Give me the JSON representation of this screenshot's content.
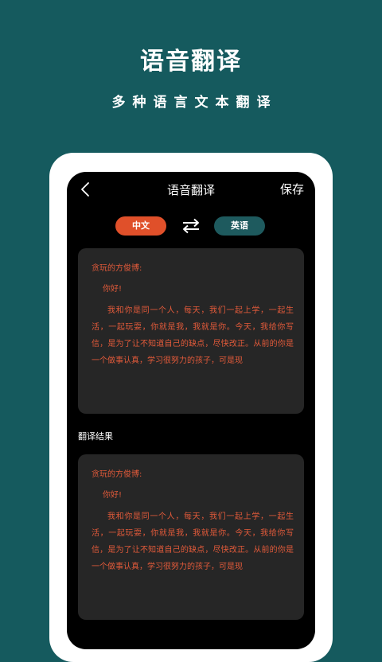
{
  "promo": {
    "title": "语音翻译",
    "subtitle": "多种语言文本翻译"
  },
  "app": {
    "nav": {
      "title": "语音翻译",
      "save_label": "保存",
      "back_icon": "chevron-left-icon"
    },
    "languages": {
      "source": "中文",
      "target": "英语",
      "swap_icon": "swap-arrows-icon"
    },
    "source_card": {
      "greeting": "贪玩的方俊博:",
      "salutation": "你好!",
      "body": "我和你是同一个人，每天，我们一起上学，一起生活，一起玩耍，你就是我，我就是你。今天，我给你写信，是为了让不知道自己的缺点，尽快改正。从前的你是一个做事认真，学习很努力的孩子，可是现"
    },
    "result_label": "翻译结果",
    "result_card": {
      "greeting": "贪玩的方俊博:",
      "salutation": "你好!",
      "body": "我和你是同一个人，每天，我们一起上学，一起生活，一起玩耍，你就是我，我就是你。今天，我给你写信，是为了让不知道自己的缺点，尽快改正。从前的你是一个做事认真，学习很努力的孩子，可是现"
    }
  },
  "colors": {
    "background": "#155a5e",
    "accent_orange": "#e0502a",
    "accent_teal": "#1e5a5e",
    "card": "#262626",
    "text_orange": "#e25a3a"
  }
}
